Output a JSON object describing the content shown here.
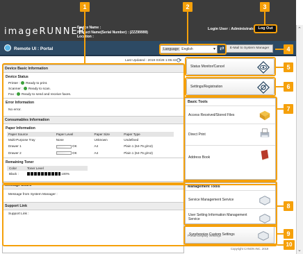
{
  "header": {
    "logo": "imageRUNNER",
    "device_name_label": "Device Name :",
    "product_label": "Product Name(Serial Number) : (ZZZ99999)",
    "location_label": "Location :",
    "login_user": "Login User : Administrator",
    "logout_label": "Log Out"
  },
  "subheader": {
    "portal_title": "Remote UI : Portal",
    "language_label": "Language",
    "language_value": "English",
    "mail_button": "E-Mail to System Manager"
  },
  "last_updated": "Last Updated : 2019 03/28 1:05:42",
  "device_basic": {
    "title": "Device Basic Information",
    "status_title": "Device Status",
    "status": [
      {
        "label": "Printer :",
        "value": "Ready to print."
      },
      {
        "label": "Scanner :",
        "value": "Ready to scan."
      },
      {
        "label": "Fax :",
        "value": "Ready to send and receive faxes."
      }
    ],
    "error_title": "Error Information",
    "error_text": "No error."
  },
  "consumables": {
    "title": "Consumables Information",
    "paper_title": "Paper Information",
    "paper_headers": [
      "Paper Source",
      "Paper Level",
      "Paper Size",
      "Paper Type"
    ],
    "paper_rows": [
      {
        "source": "Multi-Purpose Tray",
        "level": "None",
        "size": "Unknown",
        "type": "Undefined",
        "bar": false
      },
      {
        "source": "Drawer 1",
        "level": "OK",
        "size": "A4",
        "type": "Plain 1 (64-75 g/m2)",
        "bar": true
      },
      {
        "source": "Drawer 2",
        "level": "OK",
        "size": "A4",
        "type": "Plain 1 (64-75 g/m2)",
        "bar": true
      }
    ],
    "toner_title": "Remaining Toner",
    "toner_headers": [
      "Color",
      "Toner Level"
    ],
    "toner_color": "Black :",
    "toner_level": "100%",
    "toner_fraction": 1.0
  },
  "message_board": {
    "title": "Message Board",
    "text": "Message from System Manager :"
  },
  "support": {
    "title": "Support Link",
    "text": "Support Link :"
  },
  "right": {
    "status_monitor": "Status Monitor/Cancel",
    "settings": "Settings/Registration",
    "basic_tools_title": "Basic Tools",
    "basic_tools": [
      "Access Received/Stored Files",
      "Direct Print",
      "Address Book"
    ],
    "mgmt_title": "Management Tools",
    "mgmt_tools": [
      "Service Management Service",
      "User Setting Information Management Service"
    ],
    "sync": "Synchronize Custom Settings",
    "portal_display": "Portal Display Settings",
    "copyright": "Copyright CANON INC. 2019"
  },
  "callouts": [
    "1",
    "2",
    "3",
    "4",
    "5",
    "6",
    "7",
    "8",
    "9",
    "10"
  ],
  "colors": {
    "callout": "#f5a00a",
    "topbar": "#3c3c3c",
    "subbar": "#2d4a64",
    "status_ok": "#3ca03c"
  }
}
